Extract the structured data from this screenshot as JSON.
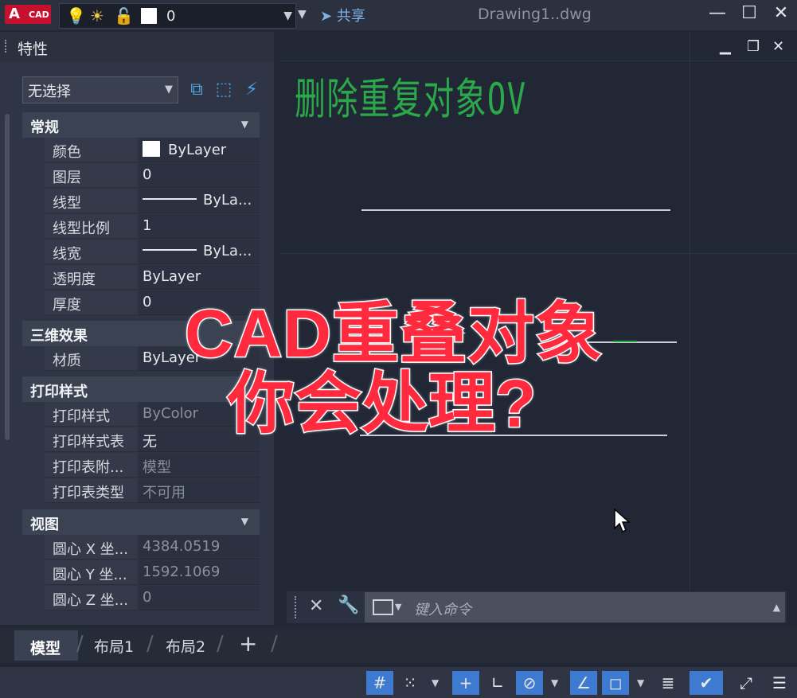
{
  "app": {
    "logo_letter": "A",
    "logo_text": "CAD",
    "document_title": "Drawing1..dwg",
    "share_label": "共享"
  },
  "layer_bar": {
    "current_layer": "0",
    "icons": [
      "lightbulb-icon",
      "sun-icon",
      "unlock-icon",
      "color-square-icon"
    ]
  },
  "properties_panel": {
    "title": "特性",
    "selection": "无选择",
    "categories": [
      {
        "label": "常规",
        "rows": [
          {
            "name": "颜色",
            "value": "ByLayer"
          },
          {
            "name": "图层",
            "value": "0"
          },
          {
            "name": "线型",
            "value": "ByLa..."
          },
          {
            "name": "线型比例",
            "value": "1"
          },
          {
            "name": "线宽",
            "value": "ByLa..."
          },
          {
            "name": "透明度",
            "value": "ByLayer"
          },
          {
            "name": "厚度",
            "value": "0"
          }
        ]
      },
      {
        "label": "三维效果",
        "rows": [
          {
            "name": "材质",
            "value": "ByLayer"
          }
        ]
      },
      {
        "label": "打印样式",
        "rows": [
          {
            "name": "打印样式",
            "value": "ByColor"
          },
          {
            "name": "打印样式表",
            "value": "无"
          },
          {
            "name": "打印表附...",
            "value": "模型"
          },
          {
            "name": "打印表类型",
            "value": "不可用"
          }
        ]
      },
      {
        "label": "视图",
        "rows": [
          {
            "name": "圆心 X 坐...",
            "value": "4384.0519"
          },
          {
            "name": "圆心 Y 坐...",
            "value": "1592.1069"
          },
          {
            "name": "圆心 Z 坐...",
            "value": "0"
          }
        ]
      }
    ]
  },
  "drawing": {
    "annotation_text": "删除重复对象OV",
    "annotation_color": "#2aa84a"
  },
  "overlay": {
    "line1": "CAD重叠对象",
    "line2": "你会处理?",
    "fill_color": "#ff2a3d"
  },
  "command_line": {
    "placeholder": "键入命令"
  },
  "layout_tabs": {
    "model": "模型",
    "layout1": "布局1",
    "layout2": "布局2",
    "add": "+"
  },
  "colors": {
    "accent": "#3e7bd0",
    "background": "#212735",
    "brand": "#c8102e"
  }
}
